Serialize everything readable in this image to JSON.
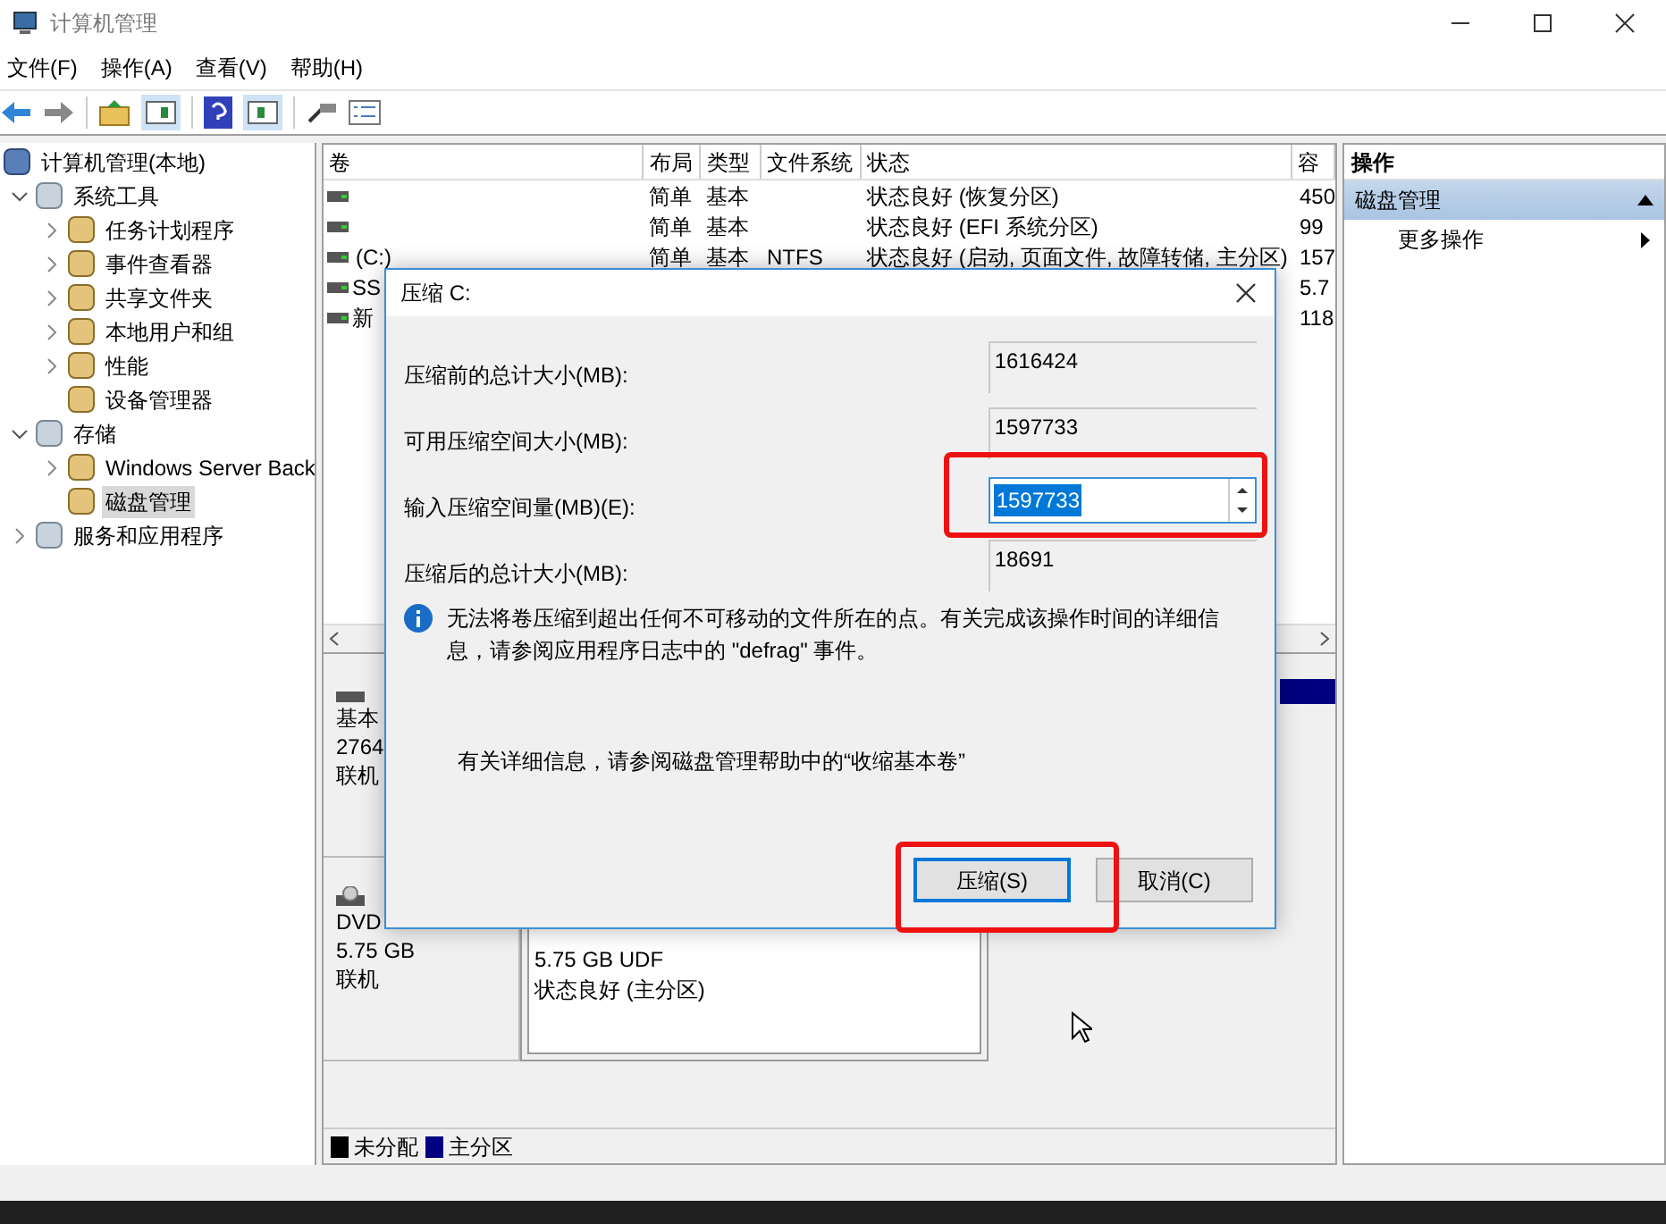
{
  "window": {
    "title": "计算机管理"
  },
  "menu": [
    "文件(F)",
    "操作(A)",
    "查看(V)",
    "帮助(H)"
  ],
  "tree": [
    {
      "label": "计算机管理(本地)",
      "selected": false,
      "children": [
        {
          "label": "系统工具",
          "expanded": true,
          "selected": false,
          "children": [
            {
              "label": "任务计划程序",
              "expanded": false,
              "selected": false
            },
            {
              "label": "事件查看器",
              "expanded": false,
              "selected": false
            },
            {
              "label": "共享文件夹",
              "expanded": false,
              "selected": false
            },
            {
              "label": "本地用户和组",
              "expanded": false,
              "selected": false
            },
            {
              "label": "性能",
              "expanded": false,
              "selected": false
            },
            {
              "label": "设备管理器",
              "selected": false
            }
          ]
        },
        {
          "label": "存储",
          "expanded": true,
          "selected": false,
          "children": [
            {
              "label": "Windows Server Back",
              "expanded": false,
              "selected": false
            },
            {
              "label": "磁盘管理",
              "selected": true
            }
          ]
        },
        {
          "label": "服务和应用程序",
          "expanded": false,
          "selected": false
        }
      ]
    }
  ],
  "table": {
    "columns": [
      "卷",
      "布局",
      "类型",
      "文件系统",
      "状态",
      "容"
    ],
    "rows": [
      {
        "cells": [
          "",
          "简单",
          "基本",
          "",
          "状态良好 (恢复分区)",
          "450"
        ]
      },
      {
        "cells": [
          "",
          "简单",
          "基本",
          "",
          "状态良好 (EFI 系统分区)",
          "99"
        ]
      },
      {
        "cells": [
          "(C:)",
          "简单",
          "基本",
          "NTFS",
          "状态良好 (启动, 页面文件, 故障转储, 主分区)",
          "157"
        ]
      },
      {
        "cells": [
          "SS",
          "",
          "",
          "",
          "",
          "5.7"
        ]
      },
      {
        "cells": [
          "新",
          "",
          "",
          "",
          "",
          "118"
        ]
      }
    ]
  },
  "disks": [
    {
      "lines": [
        "基本",
        "2764",
        "联机"
      ]
    },
    {
      "lines": [
        "DVD",
        "5.75 GB",
        "联机"
      ],
      "partition": [
        "5.75 GB UDF",
        "状态良好 (主分区)"
      ]
    }
  ],
  "legend": [
    {
      "label": "未分配",
      "color": "#000000"
    },
    {
      "label": "主分区",
      "color": "#000080"
    }
  ],
  "actions": {
    "title": "操作",
    "section": "磁盘管理",
    "items": [
      "更多操作"
    ]
  },
  "dialog": {
    "title": "压缩 C:",
    "fields": [
      {
        "label": "压缩前的总计大小(MB):",
        "value": "1616424",
        "kind": "readonly"
      },
      {
        "label": "可用压缩空间大小(MB):",
        "value": "1597733",
        "kind": "readonly"
      },
      {
        "label": "输入压缩空间量(MB)(E):",
        "value": "1597733",
        "kind": "spin"
      },
      {
        "label": "压缩后的总计大小(MB):",
        "value": "18691",
        "kind": "readonly"
      }
    ],
    "info": "无法将卷压缩到超出任何不可移动的文件所在的点。有关完成该操作时间的详细信息，请参阅应用程序日志中的 \"defrag\" 事件。",
    "help": "有关详细信息，请参阅磁盘管理帮助中的“收缩基本卷”",
    "buttons": [
      {
        "label": "压缩(S)",
        "default": true
      },
      {
        "label": "取消(C)",
        "default": false
      }
    ]
  }
}
